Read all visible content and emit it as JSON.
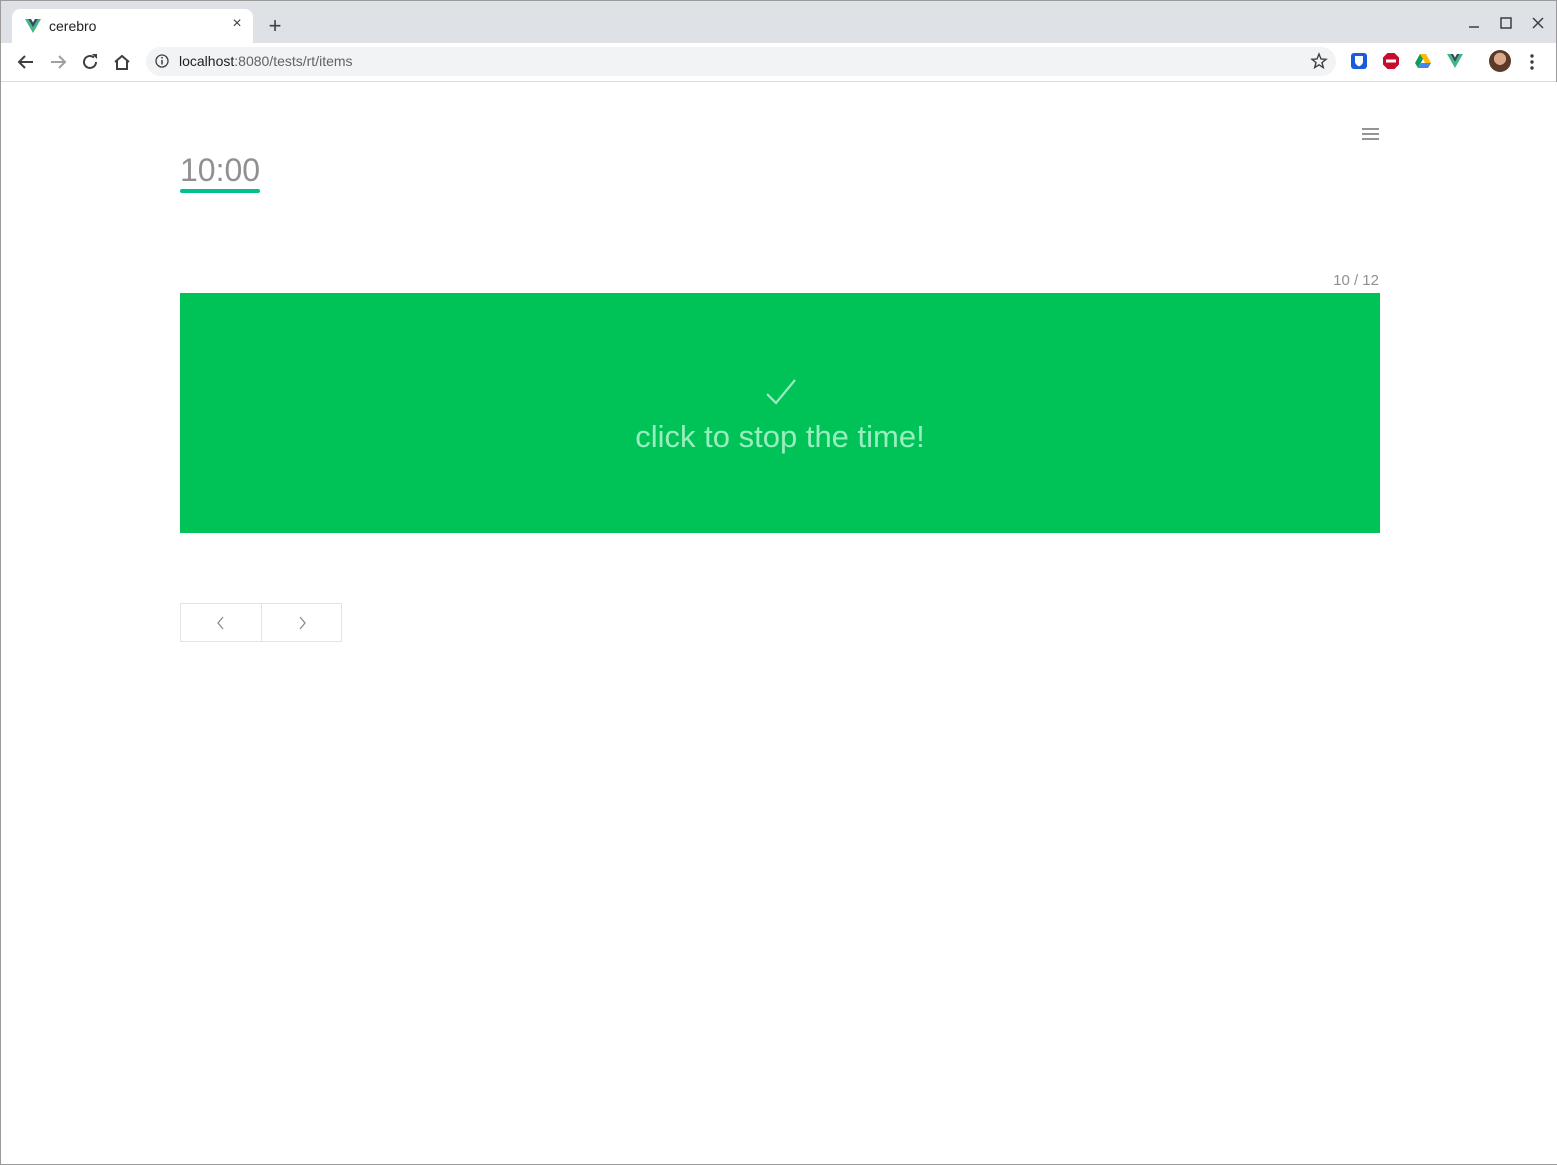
{
  "browser": {
    "tab": {
      "title": "cerebro",
      "close_icon": "×"
    },
    "new_tab_icon": "+",
    "window_controls": {
      "minimize": "–",
      "maximize": "☐",
      "close": "✕"
    },
    "address": {
      "host": "localhost",
      "rest": ":8080/tests/rt/items"
    }
  },
  "page": {
    "timer": "10:00",
    "progress": "10 / 12",
    "stop_label": "click to stop the time!",
    "colors": {
      "panel": "#00c357",
      "accent": "#00c18e",
      "label": "#99eec0"
    }
  }
}
